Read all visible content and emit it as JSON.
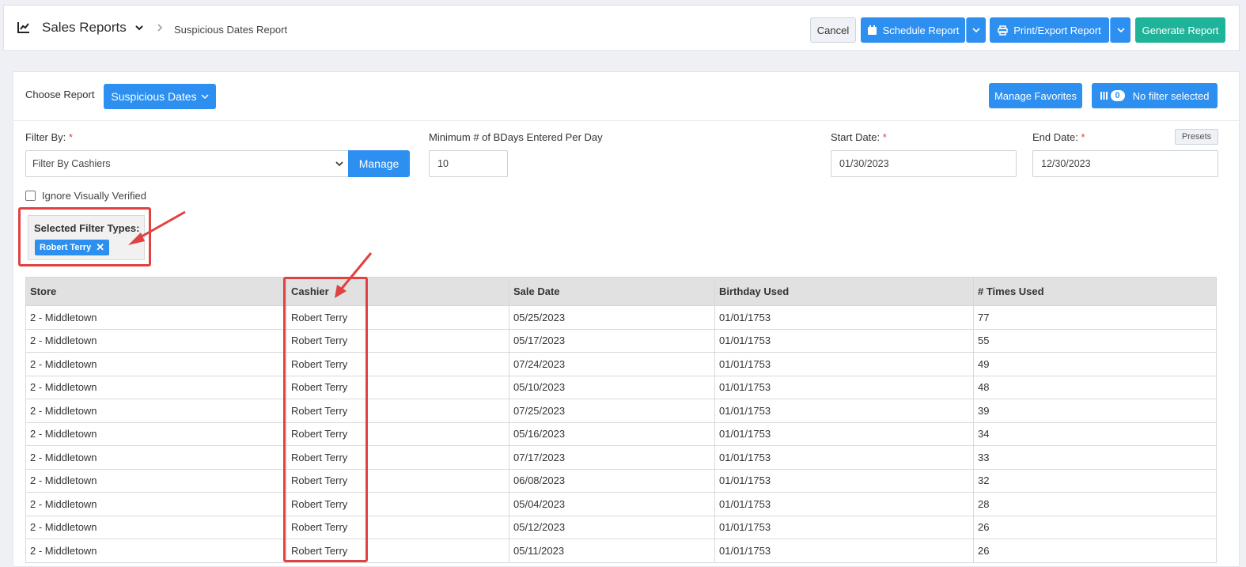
{
  "header": {
    "title": "Sales Reports",
    "breadcrumb": "Suspicious Dates Report",
    "cancel": "Cancel",
    "schedule": "Schedule Report",
    "print": "Print/Export Report",
    "generate": "Generate Report"
  },
  "toolbar": {
    "choose_label": "Choose Report",
    "choose_value": "Suspicious Dates",
    "favorites": "Manage Favorites",
    "filter_count": "0",
    "no_filter": "No filter selected"
  },
  "filters": {
    "filter_by_label": "Filter By:",
    "filter_by_value": "Filter By Cashiers",
    "manage": "Manage",
    "min_label": "Minimum # of BDays Entered Per Day",
    "min_value": "10",
    "start_label": "Start Date:",
    "start_value": "01/30/2023",
    "end_label": "End Date:",
    "end_value": "12/30/2023",
    "presets": "Presets",
    "ignore_label": "Ignore Visually Verified",
    "selected_title": "Selected Filter Types:",
    "selected_tag": "Robert Terry"
  },
  "table": {
    "columns": [
      "Store",
      "Cashier",
      "Sale Date",
      "Birthday Used",
      "# Times Used"
    ],
    "rows": [
      [
        "2 - Middletown",
        "Robert Terry",
        "05/25/2023",
        "01/01/1753",
        "77"
      ],
      [
        "2 - Middletown",
        "Robert Terry",
        "05/17/2023",
        "01/01/1753",
        "55"
      ],
      [
        "2 - Middletown",
        "Robert Terry",
        "07/24/2023",
        "01/01/1753",
        "49"
      ],
      [
        "2 - Middletown",
        "Robert Terry",
        "05/10/2023",
        "01/01/1753",
        "48"
      ],
      [
        "2 - Middletown",
        "Robert Terry",
        "07/25/2023",
        "01/01/1753",
        "39"
      ],
      [
        "2 - Middletown",
        "Robert Terry",
        "05/16/2023",
        "01/01/1753",
        "34"
      ],
      [
        "2 - Middletown",
        "Robert Terry",
        "07/17/2023",
        "01/01/1753",
        "33"
      ],
      [
        "2 - Middletown",
        "Robert Terry",
        "06/08/2023",
        "01/01/1753",
        "32"
      ],
      [
        "2 - Middletown",
        "Robert Terry",
        "05/04/2023",
        "01/01/1753",
        "28"
      ],
      [
        "2 - Middletown",
        "Robert Terry",
        "05/12/2023",
        "01/01/1753",
        "26"
      ],
      [
        "2 - Middletown",
        "Robert Terry",
        "05/11/2023",
        "01/01/1753",
        "26"
      ]
    ]
  },
  "colors": {
    "primary": "#2d8ff0",
    "success": "#1fb39a",
    "annotation": "#e04141"
  }
}
